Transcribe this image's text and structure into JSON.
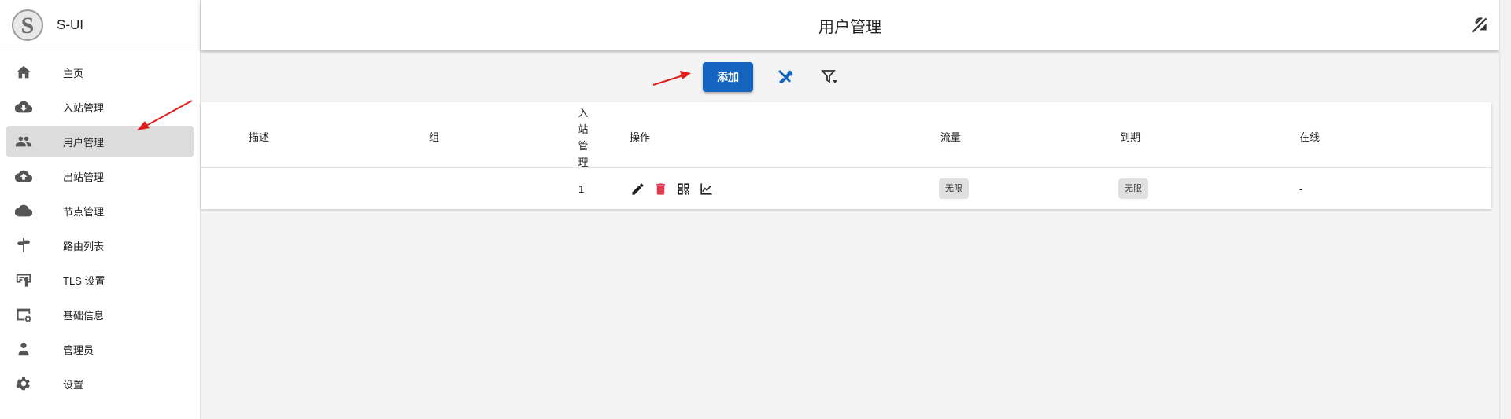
{
  "brand": {
    "name": "S-UI"
  },
  "sidebar": {
    "items": [
      {
        "label": "主页",
        "icon": "home-icon"
      },
      {
        "label": "入站管理",
        "icon": "cloud-download-icon"
      },
      {
        "label": "用户管理",
        "icon": "users-icon",
        "active": true
      },
      {
        "label": "出站管理",
        "icon": "cloud-upload-icon"
      },
      {
        "label": "节点管理",
        "icon": "cloud-sync-icon"
      },
      {
        "label": "路由列表",
        "icon": "signpost-icon"
      },
      {
        "label": "TLS 设置",
        "icon": "certificate-icon"
      },
      {
        "label": "基础信息",
        "icon": "settings-card-icon"
      },
      {
        "label": "管理员",
        "icon": "admin-icon"
      },
      {
        "label": "设置",
        "icon": "gear-icon"
      }
    ]
  },
  "header": {
    "title": "用户管理",
    "theme_icon": "theme-toggle-icon"
  },
  "toolbar": {
    "add_label": "添加",
    "tools_icon": "wrench-icon",
    "filter_icon": "filter-icon"
  },
  "table": {
    "columns": {
      "desc": "描述",
      "group": "组",
      "inbound": [
        "入",
        "站",
        "管",
        "理"
      ],
      "actions": "操作",
      "traffic": "流量",
      "expiry": "到期",
      "online": "在线"
    },
    "rows": [
      {
        "desc": "",
        "group": "",
        "inbound": "1",
        "traffic": "无限",
        "expiry": "无限",
        "online": "-"
      }
    ]
  },
  "colors": {
    "primary": "#1565c0",
    "delete": "#e53950",
    "active_nav": "#dcdcdc",
    "arrow": "#e11d1d"
  }
}
